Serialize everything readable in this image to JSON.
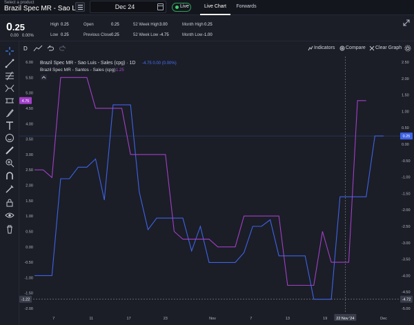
{
  "header": {
    "product_caption": "Select a product",
    "product_name": "Brazil Spec MR - Sao Luis - Sale...",
    "date": "Dec 24",
    "live_label": "Live",
    "tabs": [
      {
        "label": "Live Chart"
      },
      {
        "label": "Forwards"
      }
    ]
  },
  "stats": {
    "price_int": "0",
    "price_dec": ".25",
    "change": "0.00",
    "change_pct": "0.00%",
    "items": [
      {
        "label": "High",
        "value": "0.25"
      },
      {
        "label": "Low",
        "value": "0.25"
      },
      {
        "label": "Open",
        "value": "0.25"
      },
      {
        "label": "Previous Close",
        "value": "0.25"
      },
      {
        "label": "52 Week High",
        "value": "3.00"
      },
      {
        "label": "52 Week Low",
        "value": "-4.75"
      },
      {
        "label": "Month High",
        "value": "0.25"
      },
      {
        "label": "Month Low",
        "value": "-1.00"
      }
    ]
  },
  "toolbar": {
    "interval": "D",
    "indicators": "Indicators",
    "compare": "Compare",
    "clear": "Clear Graph"
  },
  "left_tools": [
    "crosshair-icon",
    "trendline-icon",
    "fib-icon",
    "pattern-icon",
    "measure-icon",
    "brush-icon",
    "text-icon",
    "emoji-icon",
    "ruler-icon",
    "zoom-in-icon",
    "magnet-icon",
    "lock-drawing-icon",
    "lock-icon",
    "eye-icon",
    "trash-icon"
  ],
  "colors": {
    "series1": "#3f63e8",
    "series2": "#a33fc8",
    "background": "#1b1e27"
  },
  "chart_data": {
    "type": "line",
    "legend": [
      {
        "name": "Brazil Spec MR - Sao Luis - Sales (cpg) · 1D",
        "values_text": "-4.75  0.00 (0.00%)"
      },
      {
        "name": "Brazil Spec MR - Santos - Sales (cpg)",
        "values_text": "-1.25"
      }
    ],
    "x_ticks": [
      "7",
      "11",
      "17",
      "23",
      "Nov",
      "7",
      "13",
      "19",
      "22 Nov '24",
      "Dec"
    ],
    "y_left": {
      "ticks": [
        "6.00",
        "5.50",
        "5.00",
        "4.50",
        "4.00",
        "3.50",
        "3.00",
        "2.50",
        "2.00",
        "1.50",
        "1.00",
        "0.50",
        "0.00",
        "-0.50",
        "-1.00",
        "-1.50",
        "-2.00"
      ],
      "range": [
        -2.0,
        6.0
      ]
    },
    "y_right": {
      "ticks": [
        "2.50",
        "2.00",
        "1.50",
        "1.00",
        "0.50",
        "0.00",
        "-0.50",
        "-1.00",
        "-1.50",
        "-2.00",
        "-2.50",
        "-3.00",
        "-3.50",
        "-4.00",
        "-4.50",
        "-5.00"
      ],
      "range": [
        -5.0,
        2.5
      ]
    },
    "labels": {
      "left_tag": "4.75",
      "left_bottom_tag": "-1.22",
      "right_tag": "0.25",
      "right_bottom_tag": "-4.72"
    },
    "series": [
      {
        "name": "Brazil Spec MR - Sao Luis - Sales (cpg)",
        "axis": "right",
        "points": [
          [
            0,
            -4.0
          ],
          [
            1,
            -4.0
          ],
          [
            2,
            -4.0
          ],
          [
            3,
            -1.05
          ],
          [
            4,
            -1.05
          ],
          [
            5,
            -0.7
          ],
          [
            6,
            -0.7
          ],
          [
            7,
            -0.45
          ],
          [
            8,
            -1.7
          ],
          [
            9,
            1.2
          ],
          [
            10,
            1.2
          ],
          [
            11,
            1.2
          ],
          [
            12,
            -1.45
          ],
          [
            13,
            -2.6
          ],
          [
            14,
            -2.25
          ],
          [
            15,
            -2.25
          ],
          [
            16,
            -2.25
          ],
          [
            17,
            -2.25
          ],
          [
            18,
            -3.25
          ],
          [
            19,
            -2.5
          ],
          [
            20,
            -3.6
          ],
          [
            21,
            -3.6
          ],
          [
            22,
            -3.6
          ],
          [
            23,
            -3.6
          ],
          [
            24,
            -3.3
          ],
          [
            25,
            -2.5
          ],
          [
            26,
            -2.5
          ],
          [
            27,
            -2.3
          ],
          [
            28,
            -3.4
          ],
          [
            29,
            -3.4
          ],
          [
            30,
            -3.4
          ],
          [
            31,
            -3.4
          ],
          [
            32,
            -4.72
          ],
          [
            33,
            -4.72
          ],
          [
            34,
            -4.72
          ],
          [
            35,
            -1.6
          ],
          [
            36,
            -1.6
          ],
          [
            37,
            -1.6
          ],
          [
            38,
            -1.6
          ],
          [
            39,
            0.25
          ],
          [
            40,
            0.25
          ]
        ]
      },
      {
        "name": "Brazil Spec MR - Santos - Sales (cpg)",
        "axis": "left",
        "points": [
          [
            0,
            2.5
          ],
          [
            1,
            2.5
          ],
          [
            2,
            2.25
          ],
          [
            3,
            5.5
          ],
          [
            4,
            5.5
          ],
          [
            5,
            5.5
          ],
          [
            6,
            5.5
          ],
          [
            7,
            4.5
          ],
          [
            8,
            4.5
          ],
          [
            9,
            4.5
          ],
          [
            10,
            4.5
          ],
          [
            11,
            3.0
          ],
          [
            12,
            3.0
          ],
          [
            13,
            3.0
          ],
          [
            14,
            3.0
          ],
          [
            15,
            3.0
          ],
          [
            16,
            0.5
          ],
          [
            17,
            0.25
          ],
          [
            18,
            0.25
          ],
          [
            19,
            0.25
          ],
          [
            20,
            0.25
          ],
          [
            21,
            0.0
          ],
          [
            22,
            0.0
          ],
          [
            23,
            0.0
          ],
          [
            24,
            1.0
          ],
          [
            25,
            1.0
          ],
          [
            26,
            1.0
          ],
          [
            27,
            1.0
          ],
          [
            28,
            1.0
          ],
          [
            29,
            -1.25
          ],
          [
            30,
            -1.25
          ],
          [
            31,
            -1.25
          ],
          [
            32,
            -1.25
          ],
          [
            33,
            0.5
          ],
          [
            34,
            -0.5
          ],
          [
            35,
            -0.5
          ],
          [
            36,
            -0.5
          ],
          [
            37,
            4.75
          ],
          [
            38,
            4.75
          ]
        ]
      }
    ]
  }
}
